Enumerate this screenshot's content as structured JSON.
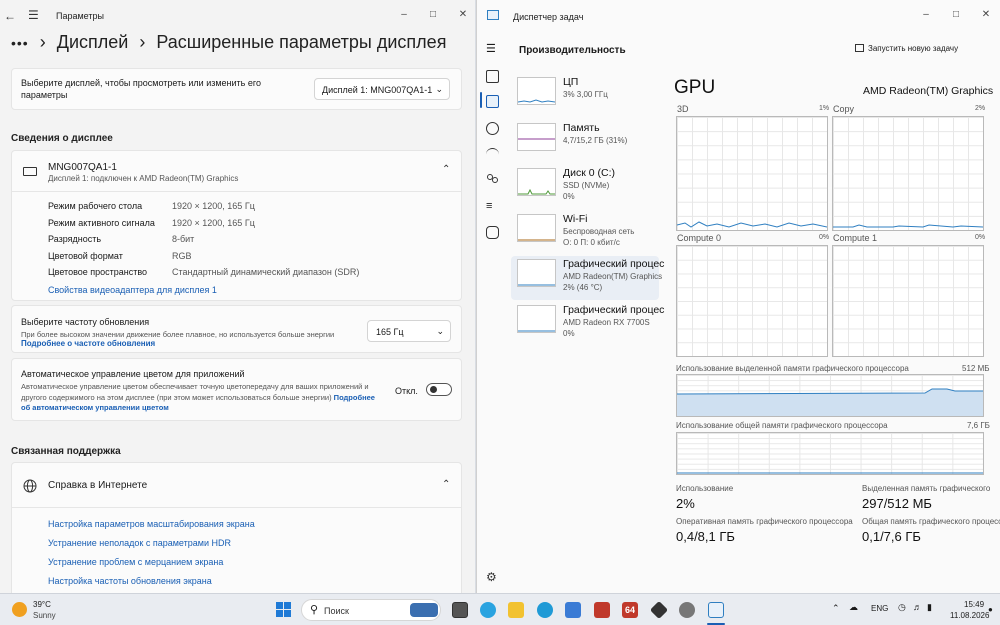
{
  "settings": {
    "app_title": "Параметры",
    "breadcrumb_parent": "Дисплей",
    "breadcrumb_current": "Расширенные параметры дисплея",
    "select_display_label": "Выберите дисплей, чтобы просмотреть или изменить его параметры",
    "select_display_value": "Дисплей 1: MNG007QA1-1",
    "display_info_heading": "Сведения о дисплее",
    "monitor_name": "MNG007QA1-1",
    "monitor_sub": "Дисплей 1: подключен к AMD Radeon(TM) Graphics",
    "details": [
      {
        "label": "Режим рабочего стола",
        "value": "1920 × 1200, 165 Гц"
      },
      {
        "label": "Режим активного сигнала",
        "value": "1920 × 1200, 165 Гц"
      },
      {
        "label": "Разрядность",
        "value": "8-бит"
      },
      {
        "label": "Цветовой формат",
        "value": "RGB"
      },
      {
        "label": "Цветовое пространство",
        "value": "Стандартный динамический диапазон (SDR)"
      }
    ],
    "adapter_link": "Свойства видеоадаптера для дисплея 1",
    "refresh_title": "Выберите частоту обновления",
    "refresh_desc": "При более высоком значении движение более плавное, но используется больше энергии",
    "refresh_link": "Подробнее о частоте обновления",
    "refresh_value": "165 Гц",
    "acm_title": "Автоматическое управление цветом для приложений",
    "acm_desc": "Автоматическое управление цветом обеспечивает точную цветопередачу для ваших приложений и другого содержимого на этом дисплее (при этом может использоваться больше энергии)",
    "acm_link": "Подробнее об автоматическом управлении цветом",
    "acm_toggle_label": "Откл.",
    "support_heading": "Связанная поддержка",
    "help_title": "Справка в Интернете",
    "help_links": [
      "Настройка параметров масштабирования экрана",
      "Устранение неполадок с параметрами HDR",
      "Устранение проблем с мерцанием экрана",
      "Настройка частоты обновления экрана"
    ]
  },
  "taskmgr": {
    "app_title": "Диспетчер задач",
    "page_title": "Производительность",
    "run_task": "Запустить новую задачу",
    "items": [
      {
        "name": "ЦП",
        "sub1": "3% 3,00 ГГц",
        "sub2": ""
      },
      {
        "name": "Память",
        "sub1": "4,7/15,2 ГБ (31%)",
        "sub2": ""
      },
      {
        "name": "Диск 0 (C:)",
        "sub1": "SSD (NVMe)",
        "sub2": "0%"
      },
      {
        "name": "Wi-Fi",
        "sub1": "Беспроводная сеть",
        "sub2": "О: 0 П: 0 кбит/с"
      },
      {
        "name": "Графический процес",
        "sub1": "AMD Radeon(TM) Graphics",
        "sub2": "2% (46 °C)"
      },
      {
        "name": "Графический процес",
        "sub1": "AMD Radeon RX 7700S",
        "sub2": "0%"
      }
    ],
    "gpu_title": "GPU",
    "gpu_name": "AMD Radeon(TM) Graphics",
    "engines": [
      {
        "name": "3D",
        "pct": "1%"
      },
      {
        "name": "Copy",
        "pct": "2%"
      },
      {
        "name": "Compute 0",
        "pct": "0%"
      },
      {
        "name": "Compute 1",
        "pct": "0%"
      }
    ],
    "dedicated_label": "Использование выделенной памяти графического процессора",
    "dedicated_max": "512 МБ",
    "shared_label": "Использование общей памяти графического процессора",
    "shared_max": "7,6 ГБ",
    "stats": [
      {
        "label": "Использование",
        "value": "2%"
      },
      {
        "label": "Выделенная память графического",
        "value": "297/512 МБ"
      },
      {
        "label": "Оперативная память графического процессора",
        "value": "0,4/8,1 ГБ"
      },
      {
        "label": "Общая память графического процессора",
        "value": "0,1/7,6 ГБ"
      }
    ]
  },
  "taskbar": {
    "temp": "39°C",
    "weather": "Sunny",
    "search": "Поиск",
    "lang": "ENG",
    "time": "15:49",
    "date": "11.08.2026",
    "app64": "64"
  },
  "colors": {
    "accent": "#1a5fb4",
    "gpu_graph": "#2f7fc1",
    "mem_graph": "#8e3c97",
    "disk_graph": "#4f9a3a",
    "wifi_graph": "#a86a1a"
  }
}
